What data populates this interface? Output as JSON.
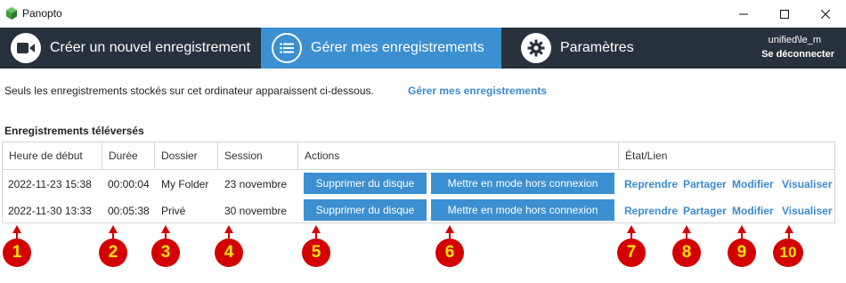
{
  "app": {
    "title": "Panopto"
  },
  "nav": {
    "create_label": "Créer un nouvel enregistrement",
    "manage_label": "Gérer mes enregistrements",
    "settings_label": "Paramètres",
    "user": "unified\\le_m",
    "signout_label": "Se déconnecter"
  },
  "info": {
    "text": "Seuls les enregistrements stockés sur cet ordinateur apparaissent ci-dessous.",
    "link": "Gérer mes enregistrements"
  },
  "section_title": "Enregistrements téléversés",
  "table": {
    "headers": [
      "Heure de début",
      "Durée",
      "Dossier",
      "Session",
      "Actions",
      "État/Lien"
    ],
    "rows": [
      {
        "start": "2022-11-23 15:38",
        "duration": "00:00:04",
        "folder": "My Folder",
        "session": "23 novembre",
        "delete_label": "Supprimer du disque",
        "offline_label": "Mettre en mode hors connexion",
        "resume": "Reprendre",
        "share": "Partager",
        "edit": "Modifier",
        "view": "Visualiser"
      },
      {
        "start": "2022-11-30 13:33",
        "duration": "00:05:38",
        "folder": "Privé",
        "session": "30 novembre",
        "delete_label": "Supprimer du disque",
        "offline_label": "Mettre en mode hors connexion",
        "resume": "Reprendre",
        "share": "Partager",
        "edit": "Modifier",
        "view": "Visualiser"
      }
    ]
  },
  "markers": [
    "1",
    "2",
    "3",
    "4",
    "5",
    "6",
    "7",
    "8",
    "9",
    "10"
  ],
  "colors": {
    "nav_bg": "#27323d",
    "accent": "#3c8fd0",
    "link": "#3b8ad1",
    "marker": "#d40000",
    "marker_text": "#ffe600"
  }
}
